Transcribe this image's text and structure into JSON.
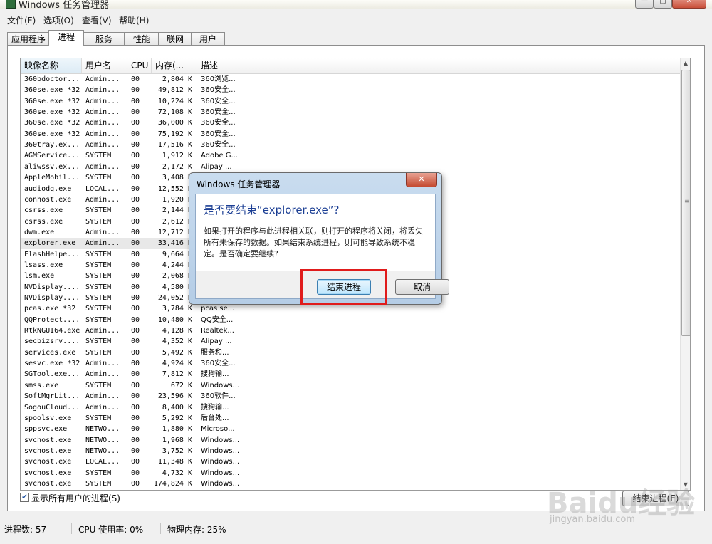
{
  "window": {
    "title": "Windows 任务管理器",
    "controls": {
      "minimize": "—",
      "maximize": "▢",
      "close": "✕"
    }
  },
  "menu": [
    "文件(F)",
    "选项(O)",
    "查看(V)",
    "帮助(H)"
  ],
  "tabs": [
    "应用程序",
    "进程",
    "服务",
    "性能",
    "联网",
    "用户"
  ],
  "active_tab": "进程",
  "process_table": {
    "columns": [
      "映像名称",
      "用户名",
      "CPU",
      "内存(...",
      "描述"
    ],
    "rows": [
      [
        "360bdoctor...",
        "Admin...",
        "00",
        "2,804 K",
        "360浏览..."
      ],
      [
        "360se.exe *32",
        "Admin...",
        "00",
        "49,812 K",
        "360安全..."
      ],
      [
        "360se.exe *32",
        "Admin...",
        "00",
        "10,224 K",
        "360安全..."
      ],
      [
        "360se.exe *32",
        "Admin...",
        "00",
        "72,108 K",
        "360安全..."
      ],
      [
        "360se.exe *32",
        "Admin...",
        "00",
        "36,000 K",
        "360安全..."
      ],
      [
        "360se.exe *32",
        "Admin...",
        "00",
        "75,192 K",
        "360安全..."
      ],
      [
        "360tray.ex...",
        "Admin...",
        "00",
        "17,516 K",
        "360安全..."
      ],
      [
        "AGMService...",
        "SYSTEM",
        "00",
        "1,912 K",
        "Adobe G..."
      ],
      [
        "aliwssv.ex...",
        "Admin...",
        "00",
        "2,172 K",
        "Alipay ..."
      ],
      [
        "AppleMobil...",
        "SYSTEM",
        "00",
        "3,408 K",
        ""
      ],
      [
        "audiodg.exe",
        "LOCAL...",
        "00",
        "12,552 K",
        ""
      ],
      [
        "conhost.exe",
        "Admin...",
        "00",
        "1,920 K",
        ""
      ],
      [
        "csrss.exe",
        "SYSTEM",
        "00",
        "2,144 K",
        ""
      ],
      [
        "csrss.exe",
        "SYSTEM",
        "00",
        "2,612 K",
        ""
      ],
      [
        "dwm.exe",
        "Admin...",
        "00",
        "12,712 K",
        ""
      ],
      [
        "explorer.exe",
        "Admin...",
        "00",
        "33,416 K",
        ""
      ],
      [
        "FlashHelpe...",
        "SYSTEM",
        "00",
        "9,664 K",
        ""
      ],
      [
        "lsass.exe",
        "SYSTEM",
        "00",
        "4,244 K",
        ""
      ],
      [
        "lsm.exe",
        "SYSTEM",
        "00",
        "2,068 K",
        ""
      ],
      [
        "NVDisplay....",
        "SYSTEM",
        "00",
        "4,580 K",
        ""
      ],
      [
        "NVDisplay....",
        "SYSTEM",
        "00",
        "24,052 K",
        ""
      ],
      [
        "pcas.exe *32",
        "SYSTEM",
        "00",
        "3,784 K",
        "pcas se..."
      ],
      [
        "QQProtect....",
        "SYSTEM",
        "00",
        "10,480 K",
        "QQ安全..."
      ],
      [
        "RtkNGUI64.exe",
        "Admin...",
        "00",
        "4,128 K",
        "Realtek..."
      ],
      [
        "secbizsrv....",
        "SYSTEM",
        "00",
        "4,352 K",
        "Alipay ..."
      ],
      [
        "services.exe",
        "SYSTEM",
        "00",
        "5,492 K",
        "服务和..."
      ],
      [
        "sesvc.exe *32",
        "Admin...",
        "00",
        "4,924 K",
        "360安全..."
      ],
      [
        "SGTool.exe...",
        "Admin...",
        "00",
        "7,812 K",
        "搜狗输..."
      ],
      [
        "smss.exe",
        "SYSTEM",
        "00",
        "672 K",
        "Windows..."
      ],
      [
        "SoftMgrLit...",
        "Admin...",
        "00",
        "23,596 K",
        "360软件..."
      ],
      [
        "SogouCloud...",
        "Admin...",
        "00",
        "8,400 K",
        "搜狗输..."
      ],
      [
        "spoolsv.exe",
        "SYSTEM",
        "00",
        "5,292 K",
        "后台处..."
      ],
      [
        "sppsvc.exe",
        "NETWO...",
        "00",
        "1,880 K",
        "Microso..."
      ],
      [
        "svchost.exe",
        "NETWO...",
        "00",
        "1,968 K",
        "Windows..."
      ],
      [
        "svchost.exe",
        "NETWO...",
        "00",
        "3,752 K",
        "Windows..."
      ],
      [
        "svchost.exe",
        "LOCAL...",
        "00",
        "11,348 K",
        "Windows..."
      ],
      [
        "svchost.exe",
        "SYSTEM",
        "00",
        "4,732 K",
        "Windows..."
      ],
      [
        "svchost.exe",
        "SYSTEM",
        "00",
        "174,824 K",
        "Windows..."
      ]
    ],
    "selected_row": 15
  },
  "show_all_users": {
    "label": "显示所有用户的进程(S)",
    "checked": true
  },
  "end_process_button": "结束进程(E)",
  "status": {
    "process_count": "进程数: 57",
    "cpu_usage": "CPU 使用率: 0%",
    "memory": "物理内存: 25%"
  },
  "dialog": {
    "title": "Windows 任务管理器",
    "heading": "是否要结束“explorer.exe”?",
    "message": "如果打开的程序与此进程相关联，则打开的程序将关闭，将丢失所有未保存的数据。如果结束系统进程，则可能导致系统不稳定。是否确定要继续?",
    "end_button": "结束进程",
    "cancel_button": "取消",
    "close": "✕"
  },
  "watermark": {
    "logo": "Baidu经验",
    "url": "jingyan.baidu.com"
  },
  "colors": {
    "highlight": "#e01b1b",
    "dialog_heading": "#1c3f94",
    "selection": "#e8e8e8"
  }
}
